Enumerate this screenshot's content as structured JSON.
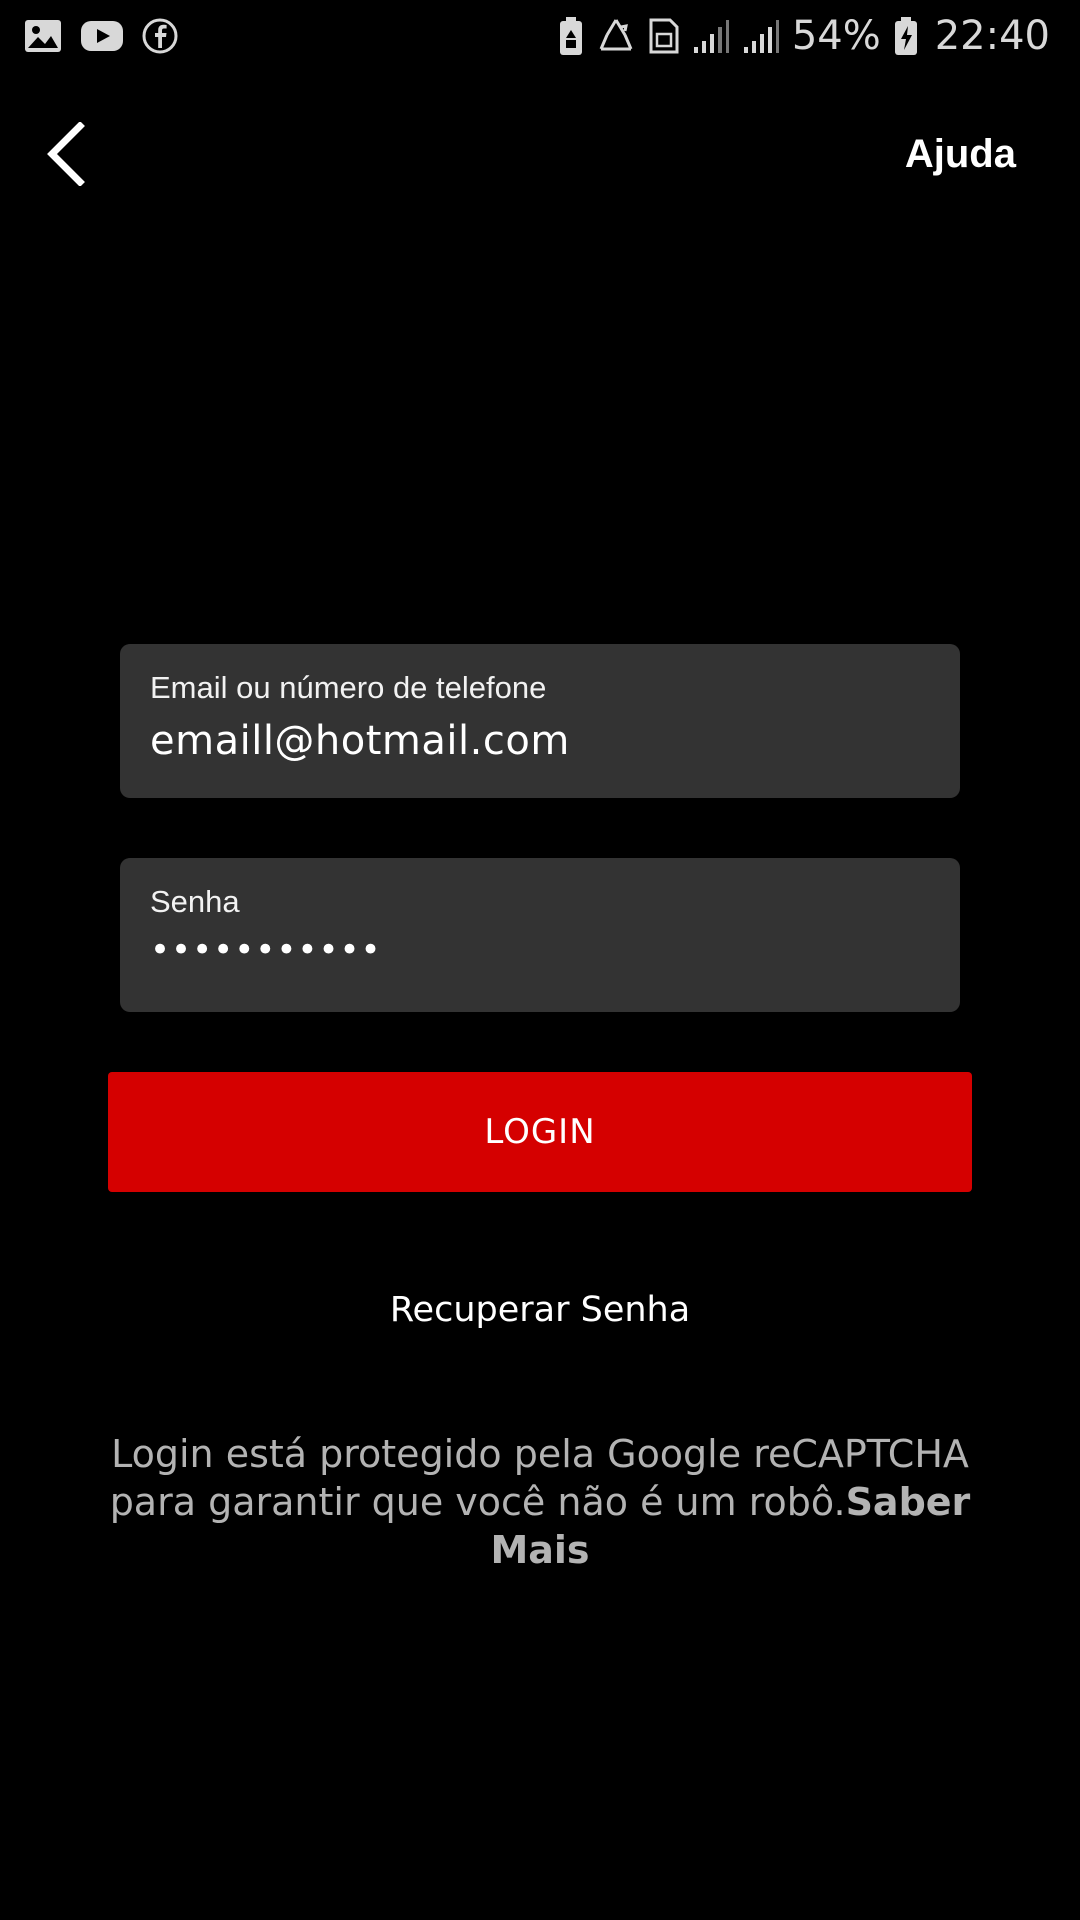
{
  "status_bar": {
    "left_icons": [
      "gallery-icon",
      "youtube-icon",
      "facebook-icon"
    ],
    "right_icons": [
      "battery-saver-icon",
      "recycle-icon",
      "sim-card-icon",
      "signal-icon",
      "signal-icon"
    ],
    "battery_percent": "54%",
    "time": "22:40"
  },
  "nav": {
    "back_icon": "chevron-left-icon",
    "help_label": "Ajuda"
  },
  "form": {
    "email": {
      "label": "Email ou número de telefone",
      "value": "emaill@hotmail.com"
    },
    "password": {
      "label": "Senha",
      "value": "•••••••••••"
    },
    "login_label": "LOGIN",
    "recover_label": "Recuperar Senha"
  },
  "recaptcha": {
    "text": "Login está protegido pela Google reCAPTCHA para garantir que você não é um robô.",
    "learn_more": "Saber Mais"
  },
  "colors": {
    "background": "#000000",
    "field_bg": "#333333",
    "accent": "#d50000",
    "muted_text": "#b3b3b3"
  }
}
